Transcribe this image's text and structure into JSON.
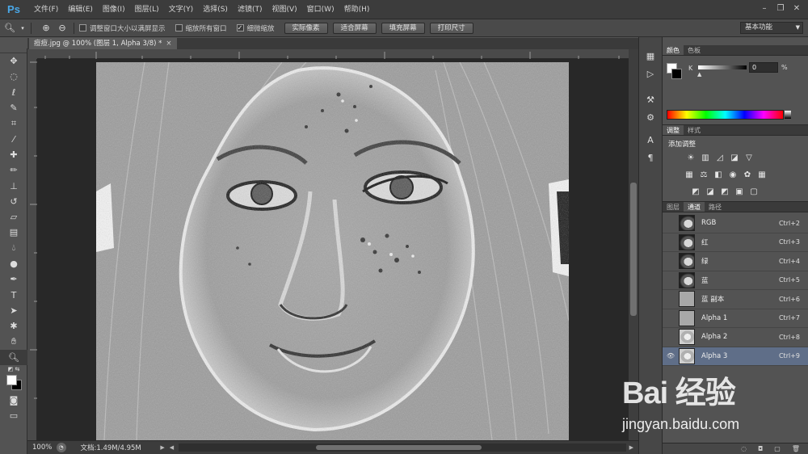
{
  "app": {
    "logo": "Ps"
  },
  "menu": [
    "文件(F)",
    "编辑(E)",
    "图像(I)",
    "图层(L)",
    "文字(Y)",
    "选择(S)",
    "滤镜(T)",
    "视图(V)",
    "窗口(W)",
    "帮助(H)"
  ],
  "window_controls": {
    "minimize": "–",
    "restore": "❐",
    "close": "✕"
  },
  "options": {
    "check_resize": "调整窗口大小以满屏显示",
    "check_zoom_all": "缩放所有窗口",
    "check_scrubby": "细微缩放",
    "btn_actual": "实际像素",
    "btn_fit": "适合屏幕",
    "btn_fill": "填充屏幕",
    "btn_print": "打印尺寸",
    "workspace": "基本功能"
  },
  "document": {
    "tab_title": "痘痘.jpg @ 100% (图层 1, Alpha 3/8) *",
    "close": "×"
  },
  "status": {
    "zoom": "100%",
    "doc_info": "文档:1.49M/4.95M"
  },
  "color_panel": {
    "tabs": [
      "颜色",
      "色板"
    ],
    "channel_label": "K",
    "value": "0",
    "unit": "%",
    "colors": {
      "foreground": "#ffffff",
      "background": "#000000"
    }
  },
  "adjust_panel": {
    "tabs": [
      "调整",
      "样式"
    ],
    "title": "添加调整"
  },
  "channels_panel": {
    "tabs": [
      "图层",
      "通道",
      "路径"
    ],
    "rows": [
      {
        "name": "RGB",
        "shortcut": "Ctrl+2"
      },
      {
        "name": "红",
        "shortcut": "Ctrl+3"
      },
      {
        "name": "绿",
        "shortcut": "Ctrl+4"
      },
      {
        "name": "蓝",
        "shortcut": "Ctrl+5"
      },
      {
        "name": "蓝 副本",
        "shortcut": "Ctrl+6"
      },
      {
        "name": "Alpha 1",
        "shortcut": "Ctrl+7"
      },
      {
        "name": "Alpha 2",
        "shortcut": "Ctrl+8"
      },
      {
        "name": "Alpha 3",
        "shortcut": "Ctrl+9"
      }
    ]
  },
  "watermark": {
    "logo": "Bai  经验",
    "url": "jingyan.baidu.com"
  },
  "theme": {
    "accent": "#4aa8e8",
    "selection": "#5f6e88"
  }
}
